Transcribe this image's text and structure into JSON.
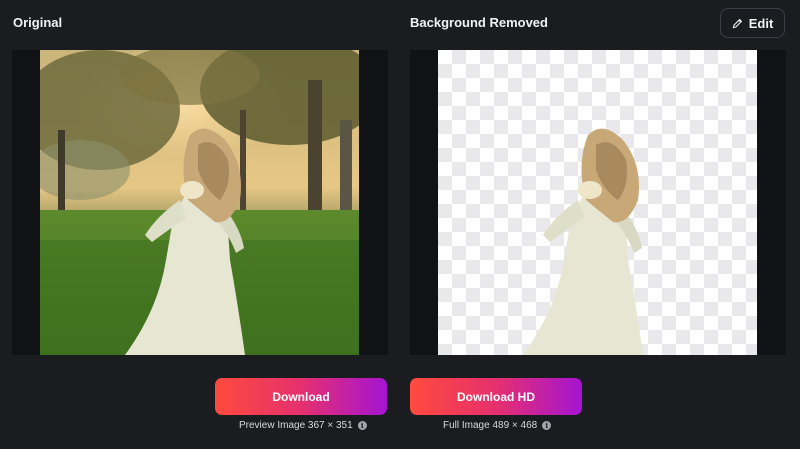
{
  "left_panel": {
    "title": "Original",
    "image_alt": "woman in white dress in grassy park",
    "download_label": "Download",
    "caption_text": "Preview Image 367 × 351",
    "info_icon": "info-icon"
  },
  "right_panel": {
    "title": "Background Removed",
    "image_alt": "woman in white dress on transparent background",
    "download_label": "Download HD",
    "caption_text": "Full Image 489 × 468",
    "info_icon": "info-icon"
  },
  "toolbar": {
    "edit_label": "Edit",
    "edit_icon": "pencil-icon"
  },
  "colors": {
    "background": "#1b1c20",
    "button_gradient_start": "#ff4a3d",
    "button_gradient_end": "#a514d2",
    "edit_border": "#3d3f46"
  }
}
